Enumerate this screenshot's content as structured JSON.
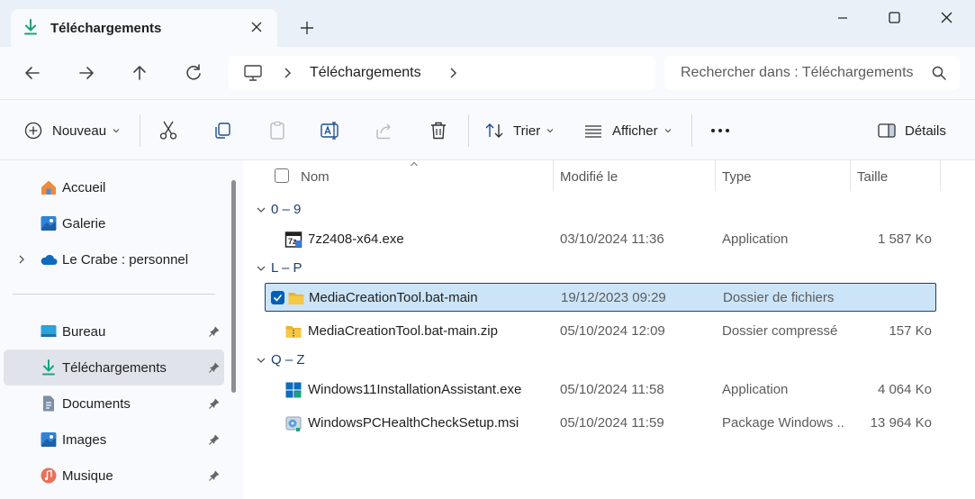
{
  "tab": {
    "title": "Téléchargements"
  },
  "address": {
    "crumb": "Téléchargements"
  },
  "search": {
    "placeholder": "Rechercher dans : Téléchargements"
  },
  "toolbar": {
    "new_label": "Nouveau",
    "sort_label": "Trier",
    "view_label": "Afficher",
    "details_label": "Détails"
  },
  "sidebar": {
    "items": [
      {
        "label": "Accueil",
        "icon": "home-icon"
      },
      {
        "label": "Galerie",
        "icon": "gallery-icon"
      },
      {
        "label": "Le Crabe : personnel",
        "icon": "onedrive-cloud-icon"
      },
      {
        "label": "Bureau",
        "icon": "desktop-icon"
      },
      {
        "label": "Téléchargements",
        "icon": "download-icon"
      },
      {
        "label": "Documents",
        "icon": "documents-icon"
      },
      {
        "label": "Images",
        "icon": "pictures-icon"
      },
      {
        "label": "Musique",
        "icon": "music-icon"
      }
    ]
  },
  "columns": {
    "name": "Nom",
    "modified": "Modifié le",
    "type": "Type",
    "size": "Taille"
  },
  "groups": [
    {
      "label": "0 – 9"
    },
    {
      "label": "L – P"
    },
    {
      "label": "Q – Z"
    }
  ],
  "files": [
    {
      "name": "7z2408-x64.exe",
      "date": "03/10/2024 11:36",
      "type": "Application",
      "size": "1 587 Ko",
      "icon": "7zip-installer-icon"
    },
    {
      "name": "MediaCreationTool.bat-main",
      "date": "19/12/2023 09:29",
      "type": "Dossier de fichiers",
      "size": "",
      "icon": "folder-icon",
      "selected": true
    },
    {
      "name": "MediaCreationTool.bat-main.zip",
      "date": "05/10/2024 12:09",
      "type": "Dossier compressé",
      "size": "157 Ko",
      "icon": "zip-folder-icon"
    },
    {
      "name": "Windows11InstallationAssistant.exe",
      "date": "05/10/2024 11:58",
      "type": "Application",
      "size": "4 064 Ko",
      "icon": "windows-logo-icon"
    },
    {
      "name": "WindowsPCHealthCheckSetup.msi",
      "date": "05/10/2024 11:59",
      "type": "Package Windows ...",
      "size": "13 964 Ko",
      "icon": "msi-installer-icon"
    }
  ],
  "colors": {
    "accent": "#005fb8",
    "selection_bg": "#cce4f7",
    "download_green": "#1aa37a",
    "folder_yellow": "#f7c843"
  }
}
